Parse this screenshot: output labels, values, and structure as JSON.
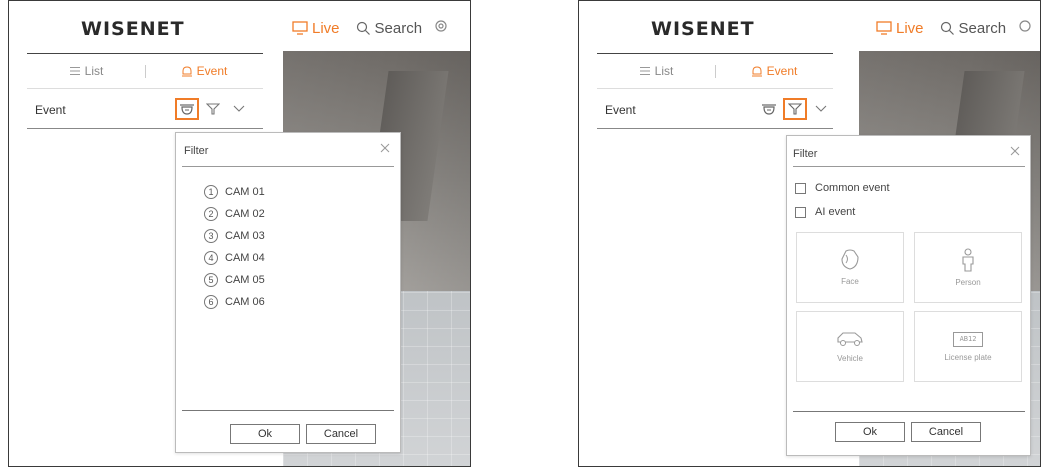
{
  "panels": [
    {
      "header": {
        "logo": "WISENET",
        "nav_live": "Live",
        "nav_search": "Search"
      },
      "tabs": {
        "list_label": "List",
        "event_label": "Event"
      },
      "event_row": {
        "label": "Event",
        "highlighted_icon": "camera-dome-icon"
      },
      "dialog": {
        "title": "Filter",
        "cameras": [
          {
            "num": "1",
            "name": "CAM 01"
          },
          {
            "num": "2",
            "name": "CAM 02"
          },
          {
            "num": "3",
            "name": "CAM 03"
          },
          {
            "num": "4",
            "name": "CAM 04"
          },
          {
            "num": "5",
            "name": "CAM 05"
          },
          {
            "num": "6",
            "name": "CAM 06"
          }
        ],
        "ok_label": "Ok",
        "cancel_label": "Cancel"
      }
    },
    {
      "header": {
        "logo": "WISENET",
        "nav_live": "Live",
        "nav_search": "Search"
      },
      "tabs": {
        "list_label": "List",
        "event_label": "Event"
      },
      "event_row": {
        "label": "Event",
        "highlighted_icon": "filter-icon"
      },
      "dialog": {
        "title": "Filter",
        "checks": [
          {
            "label": "Common event",
            "checked": false
          },
          {
            "label": "AI event",
            "checked": false
          }
        ],
        "ai_types": [
          {
            "label": "Face",
            "icon": "face-icon"
          },
          {
            "label": "Person",
            "icon": "person-icon"
          },
          {
            "label": "Vehicle",
            "icon": "vehicle-icon"
          },
          {
            "label": "License plate",
            "icon": "license-plate-icon",
            "plate_text": "AB12"
          }
        ],
        "ok_label": "Ok",
        "cancel_label": "Cancel"
      }
    }
  ],
  "colors": {
    "accent": "#f07c28",
    "border": "#3a3a3a"
  }
}
